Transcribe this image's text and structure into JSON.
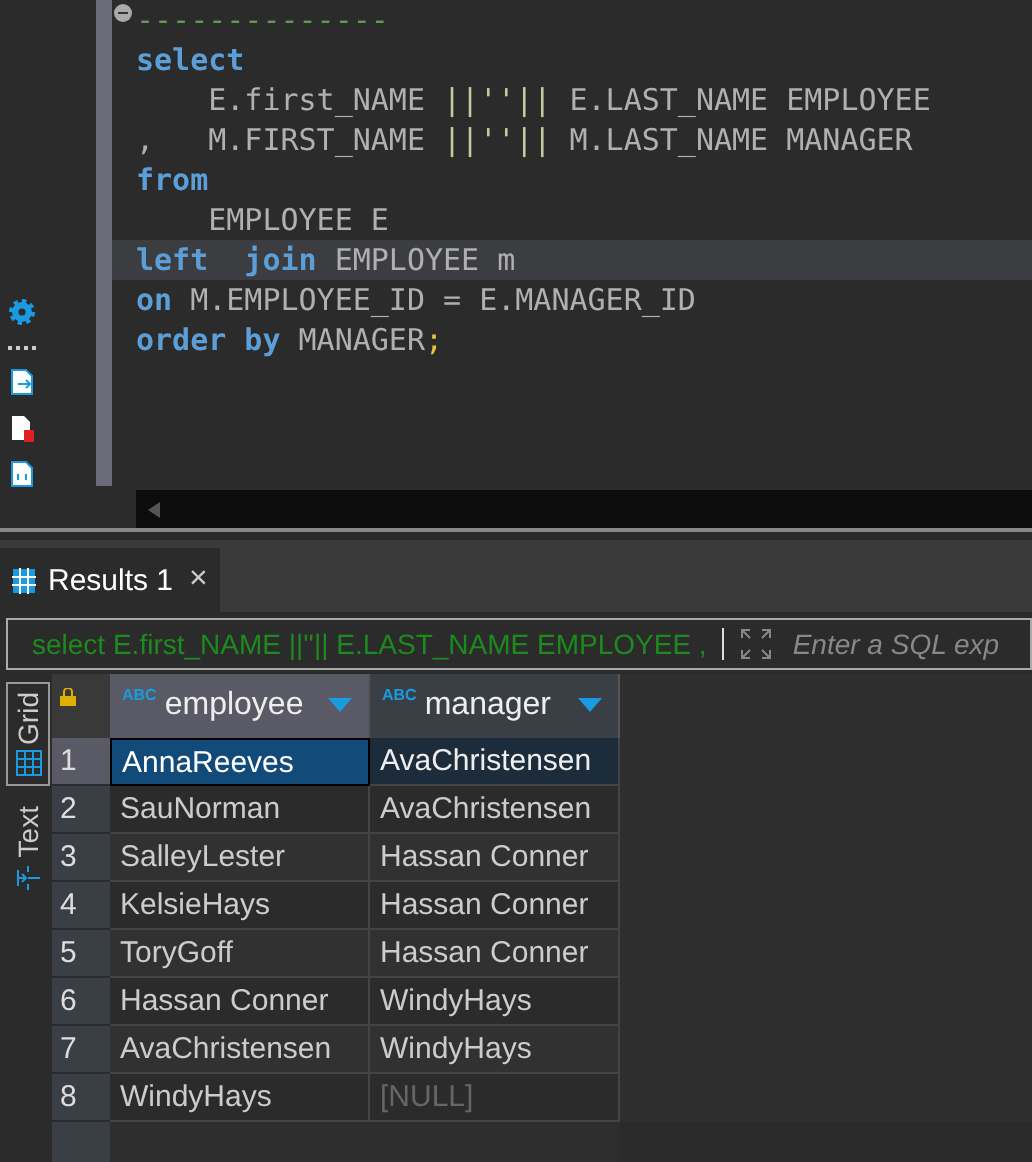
{
  "editor": {
    "lines": [
      {
        "current": false,
        "folded": true,
        "tokens": [
          {
            "text": "--------------",
            "kind": "comment"
          }
        ]
      },
      {
        "current": false,
        "folded": false,
        "tokens": [
          {
            "text": "select",
            "kind": "keyword"
          }
        ]
      },
      {
        "current": false,
        "folded": false,
        "tokens": [
          {
            "text": "    E.first_NAME ",
            "kind": "ident"
          },
          {
            "text": "||''||",
            "kind": "string"
          },
          {
            "text": " E.LAST_NAME EMPLOYEE",
            "kind": "ident"
          }
        ]
      },
      {
        "current": false,
        "folded": false,
        "tokens": [
          {
            "text": ",   M.FIRST_NAME ",
            "kind": "ident"
          },
          {
            "text": "||''||",
            "kind": "string"
          },
          {
            "text": " M.LAST_NAME MANAGER",
            "kind": "ident"
          }
        ]
      },
      {
        "current": false,
        "folded": false,
        "tokens": [
          {
            "text": "from",
            "kind": "keyword"
          }
        ]
      },
      {
        "current": false,
        "folded": false,
        "tokens": [
          {
            "text": "    EMPLOYEE E",
            "kind": "ident"
          }
        ]
      },
      {
        "current": true,
        "folded": false,
        "tokens": [
          {
            "text": "left  join",
            "kind": "keyword"
          },
          {
            "text": " EMPLOYEE m",
            "kind": "ident"
          }
        ]
      },
      {
        "current": false,
        "folded": false,
        "tokens": [
          {
            "text": "on",
            "kind": "keyword"
          },
          {
            "text": " M.EMPLOYEE_ID = E.MANAGER_ID",
            "kind": "ident"
          }
        ]
      },
      {
        "current": false,
        "folded": false,
        "tokens": [
          {
            "text": "order by",
            "kind": "keyword"
          },
          {
            "text": " MANAGER",
            "kind": "ident"
          },
          {
            "text": ";",
            "kind": "punct"
          }
        ]
      }
    ]
  },
  "side_tools": [
    {
      "kind": "gear"
    },
    {
      "kind": "dots"
    },
    {
      "kind": "doc-arrow"
    },
    {
      "kind": "doc-error"
    },
    {
      "kind": "doc-var"
    }
  ],
  "results_tab": {
    "label": "Results 1",
    "close": "×"
  },
  "filter": {
    "value": "select E.first_NAME ||''|| E.LAST_NAME EMPLOYEE ,",
    "placeholder": "Enter a SQL exp"
  },
  "view_tabs": [
    {
      "label": "Grid",
      "kind": "grid",
      "selected": true
    },
    {
      "label": "Text",
      "kind": "text",
      "selected": false
    }
  ],
  "table": {
    "columns": [
      {
        "type": "ABC",
        "label": "employee"
      },
      {
        "type": "ABC",
        "label": "manager"
      }
    ],
    "rows": [
      {
        "num": "1",
        "selected": true,
        "cells": [
          {
            "text": "AnnaReeves",
            "kind": "value",
            "focused": true
          },
          {
            "text": "AvaChristensen",
            "kind": "value",
            "focused": false
          }
        ]
      },
      {
        "num": "2",
        "selected": false,
        "cells": [
          {
            "text": "SauNorman",
            "kind": "value",
            "focused": false
          },
          {
            "text": "AvaChristensen",
            "kind": "value",
            "focused": false
          }
        ]
      },
      {
        "num": "3",
        "selected": false,
        "cells": [
          {
            "text": "SalleyLester",
            "kind": "value",
            "focused": false
          },
          {
            "text": "Hassan Conner",
            "kind": "value",
            "focused": false
          }
        ]
      },
      {
        "num": "4",
        "selected": false,
        "cells": [
          {
            "text": "KelsieHays",
            "kind": "value",
            "focused": false
          },
          {
            "text": "Hassan Conner",
            "kind": "value",
            "focused": false
          }
        ]
      },
      {
        "num": "5",
        "selected": false,
        "cells": [
          {
            "text": "ToryGoff",
            "kind": "value",
            "focused": false
          },
          {
            "text": "Hassan Conner",
            "kind": "value",
            "focused": false
          }
        ]
      },
      {
        "num": "6",
        "selected": false,
        "cells": [
          {
            "text": "Hassan Conner",
            "kind": "value",
            "focused": false
          },
          {
            "text": "WindyHays",
            "kind": "value",
            "focused": false
          }
        ]
      },
      {
        "num": "7",
        "selected": false,
        "cells": [
          {
            "text": "AvaChristensen",
            "kind": "value",
            "focused": false
          },
          {
            "text": "WindyHays",
            "kind": "value",
            "focused": false
          }
        ]
      },
      {
        "num": "8",
        "selected": false,
        "cells": [
          {
            "text": "WindyHays",
            "kind": "value",
            "focused": false
          },
          {
            "text": "[NULL]",
            "kind": "null",
            "focused": false
          }
        ]
      }
    ]
  }
}
